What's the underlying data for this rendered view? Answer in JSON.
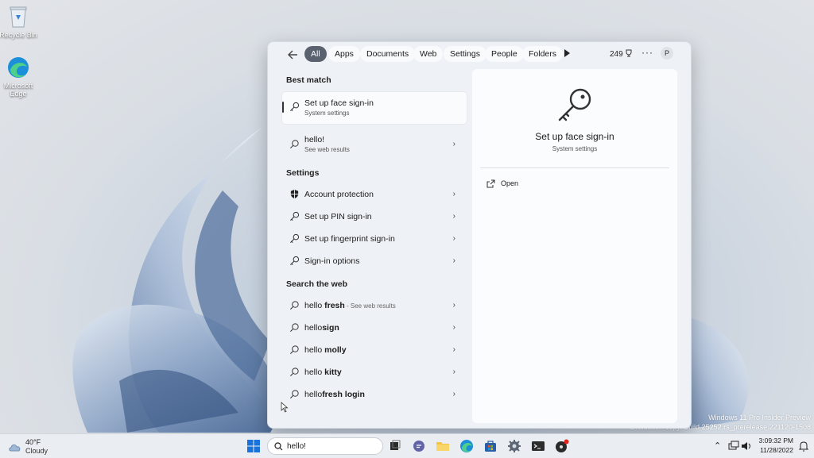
{
  "desktop": {
    "icons": [
      {
        "label": "Recycle Bin",
        "icon": "recycle-bin-icon"
      },
      {
        "label": "Microsoft Edge",
        "icon": "edge-icon"
      }
    ],
    "watermark": {
      "line1": "Windows 11 Pro Insider Preview",
      "line2": "Evaluation copy. Build 25252.rs_prerelease.221120-1508"
    }
  },
  "search_panel": {
    "filters": [
      "All",
      "Apps",
      "Documents",
      "Web",
      "Settings",
      "People",
      "Folders"
    ],
    "active_filter": "All",
    "rewards_points": "249",
    "more": "···",
    "avatar_initial": "P",
    "best_match": {
      "heading": "Best match",
      "title": "Set up face sign-in",
      "subtitle": "System settings"
    },
    "web_result": {
      "title": "hello!",
      "subtitle": "See web results"
    },
    "settings": {
      "heading": "Settings",
      "items": [
        "Account protection",
        "Set up PIN sign-in",
        "Set up fingerprint sign-in",
        "Sign-in options"
      ]
    },
    "search_web": {
      "heading": "Search the web",
      "items": [
        {
          "prefix": "hello",
          "bold": " fresh",
          "extra": " - See web results"
        },
        {
          "prefix": "hello",
          "bold": "sign",
          "extra": ""
        },
        {
          "prefix": "hello",
          "bold": " molly",
          "extra": ""
        },
        {
          "prefix": "hello",
          "bold": " kitty",
          "extra": ""
        },
        {
          "prefix": "hello",
          "bold": "fresh login",
          "extra": ""
        }
      ]
    },
    "preview": {
      "title": "Set up face sign-in",
      "subtitle": "System settings",
      "action": "Open"
    }
  },
  "taskbar": {
    "weather": {
      "temp": "40°F",
      "condition": "Cloudy"
    },
    "search_value": "hello!",
    "time": "3:09:32 PM",
    "date": "11/28/2022"
  },
  "colors": {
    "accent": "#0067c0",
    "active_chip": "#5a6270"
  }
}
